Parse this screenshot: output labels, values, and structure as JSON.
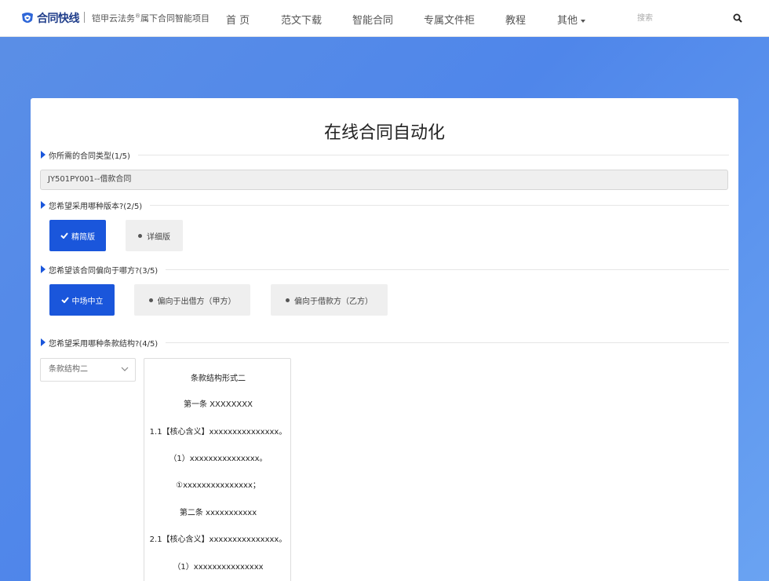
{
  "header": {
    "logo_text": "合同快线",
    "subtitle_pre": "铠甲云法务",
    "subtitle_sup": "®",
    "subtitle_post": "属下合同智能项目",
    "nav": [
      "首 页",
      "范文下载",
      "智能合同",
      "专属文件柜",
      "教程",
      "其他"
    ],
    "search_placeholder": "搜索"
  },
  "main": {
    "title": "在线合同自动化",
    "sections": [
      {
        "label": "你所需的合同类型(1/5)"
      },
      {
        "label": "您希望采用哪种版本?(2/5)"
      },
      {
        "label": "您希望该合同偏向于哪方?(3/5)"
      },
      {
        "label": "您希望采用哪种条款结构?(4/5)"
      }
    ],
    "contract_type_value": "JY501PY001--借款合同",
    "version_options": [
      {
        "label": "精简版",
        "selected": true
      },
      {
        "label": "详细版",
        "selected": false
      }
    ],
    "bias_options": [
      {
        "label": "中场中立",
        "selected": true
      },
      {
        "label": "偏向于出借方（甲方）",
        "selected": false
      },
      {
        "label": "偏向于借款方（乙方）",
        "selected": false
      }
    ],
    "structure_select": "条款结构二",
    "preview_lines": [
      "条款结构形式二",
      "第一条  XXXXXXXX",
      "1.1【核心含义】xxxxxxxxxxxxxxx。",
      "（1）xxxxxxxxxxxxxxx。",
      "①xxxxxxxxxxxxxxx；",
      "第二条  xxxxxxxxxxx",
      "2.1【核心含义】xxxxxxxxxxxxxxx。",
      "（1）xxxxxxxxxxxxxxx"
    ]
  },
  "colors": {
    "accent": "#1a56db",
    "background_gradient": "#5b8fe6",
    "option_inactive": "#efefef"
  }
}
